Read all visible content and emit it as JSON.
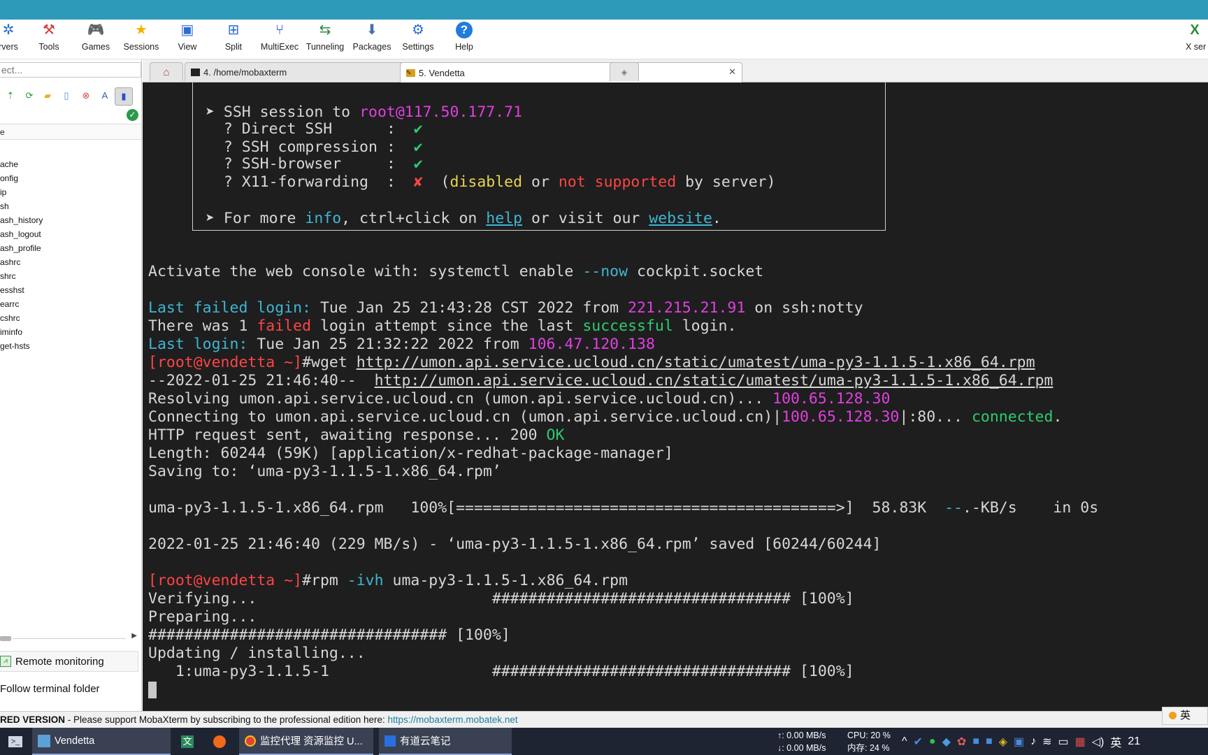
{
  "toolbar": {
    "items": [
      {
        "label": "rvers",
        "icon": "servers-icon"
      },
      {
        "label": "Tools",
        "icon": "tools-icon"
      },
      {
        "label": "Games",
        "icon": "games-icon"
      },
      {
        "label": "Sessions",
        "icon": "sessions-star-icon"
      },
      {
        "label": "View",
        "icon": "view-icon"
      },
      {
        "label": "Split",
        "icon": "split-icon"
      },
      {
        "label": "MultiExec",
        "icon": "multiexec-icon"
      },
      {
        "label": "Tunneling",
        "icon": "tunneling-icon"
      },
      {
        "label": "Packages",
        "icon": "packages-icon"
      },
      {
        "label": "Settings",
        "icon": "settings-gear-icon"
      },
      {
        "label": "Help",
        "icon": "help-icon"
      }
    ],
    "xserver_label": "X ser"
  },
  "tabs": [
    {
      "label": "4. /home/mobaxterm"
    },
    {
      "label": "5. Vendetta"
    }
  ],
  "sidebar": {
    "search_placeholder": "ect...",
    "column_header": "e",
    "files": [
      "ache",
      "onfig",
      "ip",
      "sh",
      "ash_history",
      "ash_logout",
      "ash_profile",
      "ashrc",
      "shrc",
      "esshst",
      "earrc",
      "cshrc",
      "iminfo",
      "get-hsts"
    ],
    "remote_monitoring": "Remote monitoring",
    "follow_terminal": "Follow terminal folder"
  },
  "terminal": {
    "ssh_prefix": "➤ SSH session to ",
    "ssh_host": "root@117.50.177.71",
    "direct_ssh": "  ? Direct SSH      :  ",
    "compression": "  ? SSH compression :  ",
    "browser": "  ? SSH-browser     :  ",
    "x11": "  ? X11-forwarding  :  ",
    "check": "✔",
    "cross": "✘",
    "x11_paren_open": "  (",
    "x11_disabled": "disabled",
    "x11_or": " or ",
    "x11_not_supported": "not supported",
    "x11_by_server": " by server)",
    "more_prefix": "➤ For more ",
    "more_info": "info",
    "more_mid": ", ctrl+click on ",
    "more_help": "help",
    "more_mid2": " or visit our ",
    "more_website": "website",
    "more_end": ".",
    "cockpit_pre": "Activate the web console with: systemctl enable ",
    "cockpit_flag": "--now",
    "cockpit_post": " cockpit.socket",
    "lf_label": "Last failed login:",
    "lf_time": " Tue Jan 25 21:43:28 CST 2022 from ",
    "lf_ip": "221.215.21.91",
    "lf_post": " on ssh:notty",
    "att_pre": "There was 1 ",
    "att_failed": "failed",
    "att_mid": " login attempt since the last ",
    "att_success": "successful",
    "att_post": " login.",
    "ll_label": "Last login:",
    "ll_time": " Tue Jan 25 21:32:22 2022 from ",
    "ll_ip": "106.47.120.138",
    "prompt": "[root@vendetta ~]",
    "wget_cmd": "#wget ",
    "wget_url": "http://umon.api.service.ucloud.cn/static/umatest/uma-py3-1.1.5-1.x86_64.rpm",
    "wget_time": "--2022-01-25 21:46:40--  ",
    "resolving": "Resolving umon.api.service.ucloud.cn (umon.api.service.ucloud.cn)... ",
    "resolved_ip": "100.65.128.30",
    "connecting": "Connecting to umon.api.service.ucloud.cn (umon.api.service.ucloud.cn)|",
    "connecting_ip": "100.65.128.30",
    "connecting_port": "|:80... ",
    "connected": "connected",
    "http_req": "HTTP request sent, awaiting response... 200 ",
    "http_ok": "OK",
    "length": "Length: 60244 (59K) [application/x-redhat-package-manager]",
    "saving": "Saving to: ‘uma-py3-1.1.5-1.x86_64.rpm’",
    "progress_file": "uma-py3-1.1.5-1.x86_64.rpm   100%[==========================================>]  58.83K  ",
    "progress_dash": "--",
    "progress_rate": ".-KB/s    in 0s",
    "saved": "2022-01-25 21:46:40 (229 MB/s) - ‘uma-py3-1.1.5-1.x86_64.rpm’ saved [60244/60244]",
    "rpm_cmd": "#rpm ",
    "rpm_flag": "-ivh",
    "rpm_file": " uma-py3-1.1.5-1.x86_64.rpm",
    "verifying": "Verifying...                          ################################# [100%]",
    "preparing": "Preparing...",
    "prep_hash": "################################# [100%]",
    "updating": "Updating / installing...",
    "installing": "   1:uma-py3-1.1.5-1                  ################################# [100%]"
  },
  "statusbar": {
    "edition": "RED VERSION",
    "message": "  -  Please support MobaXterm by subscribing to the professional edition here:  ",
    "link": "https://mobaxterm.mobatek.net"
  },
  "taskbar": {
    "vendetta": "Vendetta",
    "chrome_task": "监控代理 资源监控 U...",
    "youdao_task": "有道云笔记",
    "net_up": "↑: 0.00 MB/s",
    "net_down": "↓: 0.00 MB/s",
    "cpu": "CPU: 20 %",
    "mem": "内存: 24 %",
    "ime_lang": "英",
    "clock": "21"
  },
  "colors": {
    "titlebar": "#2e9ab9",
    "terminal_bg": "#1e1e1e",
    "magenta": "#e040e0",
    "green": "#2ecc71",
    "red": "#ff4444",
    "cyan": "#3fb6d4"
  }
}
